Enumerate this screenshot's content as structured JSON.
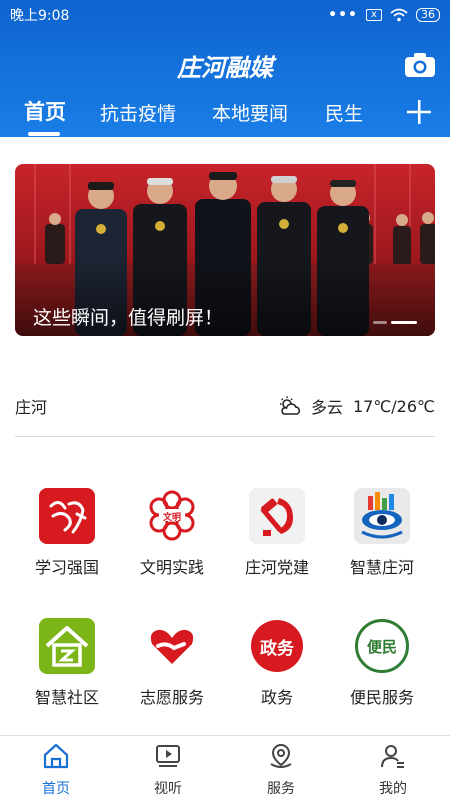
{
  "status_bar": {
    "time": "晚上9:08",
    "dots": "•••",
    "sim": "x",
    "battery": "36"
  },
  "header": {
    "title": "庄河融媒"
  },
  "tabs": [
    {
      "label": "首页"
    },
    {
      "label": "抗击疫情"
    },
    {
      "label": "本地要闻"
    },
    {
      "label": "民生"
    }
  ],
  "banner": {
    "caption": "这些瞬间，值得刷屏！",
    "slide_count": 2,
    "active_slide": 2
  },
  "weather": {
    "location": "庄河",
    "condition": "多云",
    "temperature": "17℃/26℃"
  },
  "services": [
    {
      "label": "学习强国",
      "icon": "xuexi-qiangguo-icon"
    },
    {
      "label": "文明实践",
      "icon": "wenming-shijian-icon",
      "glyph": "文明"
    },
    {
      "label": "庄河党建",
      "icon": "party-emblem-icon"
    },
    {
      "label": "智慧庄河",
      "icon": "smart-city-eye-icon"
    },
    {
      "label": "智慧社区",
      "icon": "community-house-icon"
    },
    {
      "label": "志愿服务",
      "icon": "volunteer-heart-hand-icon"
    },
    {
      "label": "政务",
      "icon": "government-affairs-icon",
      "glyph": "政务"
    },
    {
      "label": "便民服务",
      "icon": "convenience-service-icon",
      "glyph": "便民"
    }
  ],
  "bottom_nav": [
    {
      "label": "首页",
      "icon": "home-icon"
    },
    {
      "label": "视听",
      "icon": "video-play-icon"
    },
    {
      "label": "服务",
      "icon": "location-pin-icon"
    },
    {
      "label": "我的",
      "icon": "user-profile-icon"
    }
  ],
  "colors": {
    "header_blue": "#1570dc",
    "active_nav": "#1a6fd6",
    "banner_red": "#b3141b"
  }
}
